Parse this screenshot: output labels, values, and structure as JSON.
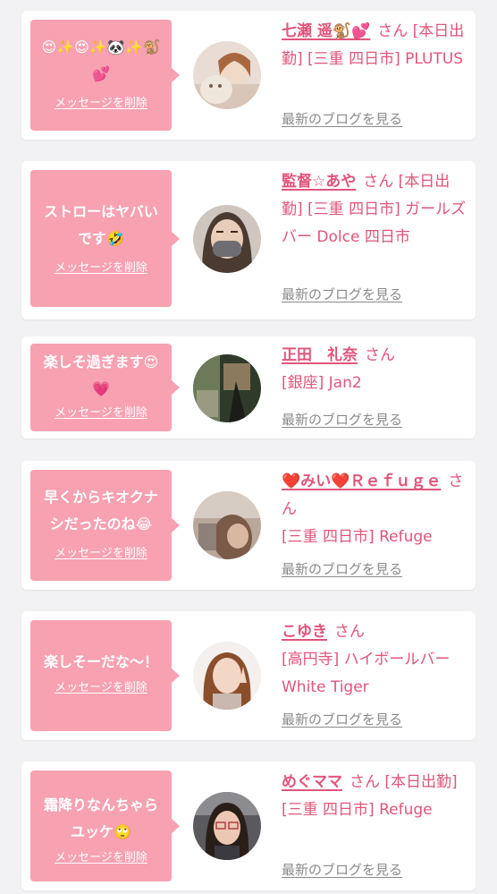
{
  "cards": [
    {
      "message": "😍✨😍✨🐼✨🐒💕",
      "delete_label": "メッセージを削除",
      "avatar": "avatar-photo-woman-with-plush",
      "name": "七瀬 遥🐒💕",
      "san": "さん",
      "detail": "[本日出勤] [三重 四日市] PLUTUS",
      "blog_label": "最新のブログを見る"
    },
    {
      "message": "ストローはヤバいです🤣",
      "delete_label": "メッセージを削除",
      "avatar": "avatar-photo-woman-with-mask",
      "name": "監督☆あや",
      "san": "さん",
      "detail": "[本日出勤] [三重 四日市] ガールズバー Dolce 四日市",
      "blog_label": "最新のブログを見る"
    },
    {
      "message": "楽しそ過ぎます😍💗",
      "delete_label": "メッセージを削除",
      "avatar": "avatar-photo-dark-room",
      "name": "正田　礼奈",
      "san": "さん",
      "detail": "[銀座] Jan2",
      "blog_label": "最新のブログを見る"
    },
    {
      "message": "早くからキオクナシだったのね😂",
      "delete_label": "メッセージを削除",
      "avatar": "avatar-photo-blurred-woman",
      "name": "❤️みい❤️Ｒｅｆｕｇｅ",
      "san": "さん",
      "detail": "[三重 四日市] Refuge",
      "blog_label": "最新のブログを見る"
    },
    {
      "message": "楽しそーだな〜！",
      "delete_label": "メッセージを削除",
      "avatar": "avatar-photo-woman-peace-sign",
      "name": "こゆき",
      "san": "さん",
      "detail": "[高円寺] ハイボールバー White Tiger",
      "blog_label": "最新のブログを見る"
    },
    {
      "message": "霜降りなんちゃらユッケ🙄",
      "delete_label": "メッセージを削除",
      "avatar": "avatar-photo-woman-with-glasses",
      "name": "めぐママ",
      "san": "さん",
      "detail": "[本日出勤] [三重 四日市] Refuge",
      "blog_label": "最新のブログを見る"
    }
  ]
}
